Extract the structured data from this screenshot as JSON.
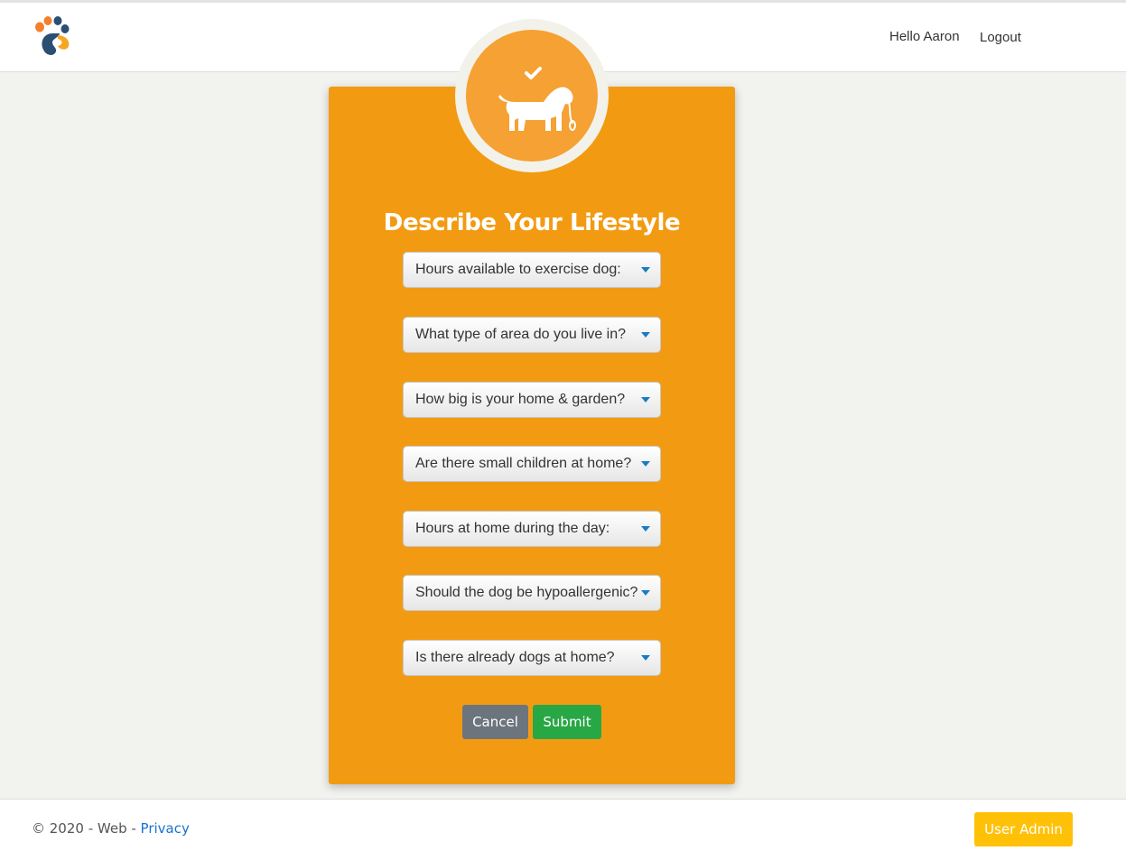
{
  "header": {
    "greeting": "Hello Aaron",
    "logout_label": "Logout",
    "logo_icon": "paw-logo-icon"
  },
  "card": {
    "badge_icon": "dog-with-leash-check-icon",
    "title": "Describe Your Lifestyle",
    "selects": [
      {
        "placeholder": "Hours available to exercise dog:"
      },
      {
        "placeholder": "What type of area do you live in?"
      },
      {
        "placeholder": "How big is your home & garden?"
      },
      {
        "placeholder": "Are there small children at home?"
      },
      {
        "placeholder": "Hours at home during the day:"
      },
      {
        "placeholder": "Should the dog be hypoallergenic?"
      },
      {
        "placeholder": "Is there already dogs at home?"
      }
    ],
    "cancel_label": "Cancel",
    "submit_label": "Submit"
  },
  "footer": {
    "copyright": "© 2020 - Web - ",
    "privacy_label": "Privacy",
    "admin_label": "User Admin"
  },
  "colors": {
    "card_bg": "#f29b12",
    "cancel": "#6c757d",
    "submit": "#28a745",
    "admin": "#ffc107",
    "link": "#1a73d0"
  }
}
